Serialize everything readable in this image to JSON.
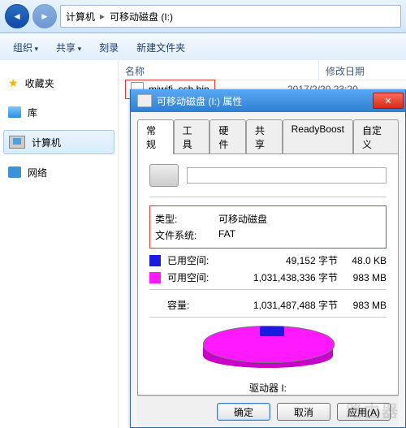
{
  "breadcrumb": {
    "seg1": "计算机",
    "seg2": "可移动磁盘 (I:)"
  },
  "toolbar": {
    "org": "组织",
    "share": "共享",
    "burn": "刻录",
    "newf": "新建文件夹"
  },
  "sidebar": {
    "fav": "收藏夹",
    "lib": "库",
    "pc": "计算机",
    "net": "网络"
  },
  "cols": {
    "name": "名称",
    "date": "修改日期"
  },
  "file": {
    "name": "miwifi_ssh.bin",
    "date": "2017/2/20 23:20"
  },
  "dialog": {
    "title": "可移动磁盘 (I:) 属性",
    "tabs": {
      "general": "常规",
      "tools": "工具",
      "hardware": "硬件",
      "sharing": "共享",
      "readyboost": "ReadyBoost",
      "custom": "自定义"
    },
    "drive_name_value": "",
    "type_label": "类型:",
    "type_value": "可移动磁盘",
    "fs_label": "文件系统:",
    "fs_value": "FAT",
    "used_label": "已用空间:",
    "used_bytes": "49,152 字节",
    "used_hr": "48.0 KB",
    "free_label": "可用空间:",
    "free_bytes": "1,031,438,336 字节",
    "free_hr": "983 MB",
    "cap_label": "容量:",
    "cap_bytes": "1,031,487,488 字节",
    "cap_hr": "983 MB",
    "drive_letter": "驱动器 I:",
    "buttons": {
      "ok": "确定",
      "cancel": "取消",
      "apply": "应用(A)"
    }
  },
  "watermark": "路由器",
  "chart_data": {
    "type": "pie",
    "title": "驱动器 I:",
    "series": [
      {
        "name": "已用空间",
        "bytes": 49152,
        "human": "48.0 KB",
        "color": "#1a1ae0"
      },
      {
        "name": "可用空间",
        "bytes": 1031438336,
        "human": "983 MB",
        "color": "#ff19ff"
      }
    ],
    "total": {
      "bytes": 1031487488,
      "human": "983 MB"
    }
  }
}
